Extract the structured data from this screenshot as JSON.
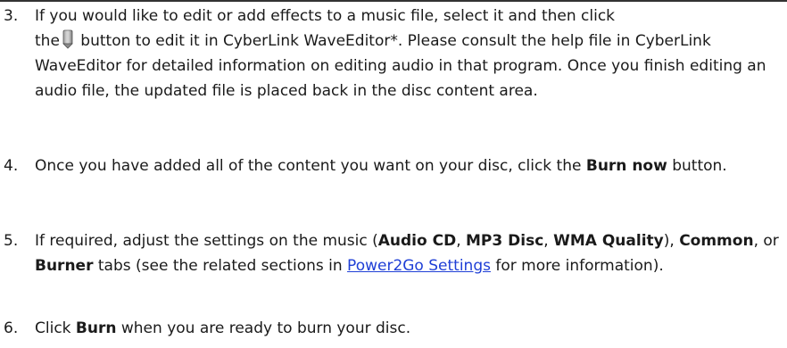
{
  "steps": [
    {
      "number": "3.",
      "line1": "If you would like to edit or add effects to a music file, select it and then click",
      "pre_icon": "the",
      "icon": "edit-pencil-icon",
      "post_icon": " button to edit it in CyberLink WaveEditor*. Please consult the help file in CyberLink WaveEditor for detailed information on editing audio in that program. Once you finish editing an audio file, the updated file is placed back in the disc content area."
    },
    {
      "number": "4.",
      "before": "Once you have added all of the content you want on your disc, click the ",
      "bold": "Burn now",
      "after": " button."
    },
    {
      "number": "5.",
      "t1": "If required, adjust the settings on the music (",
      "b1": "Audio CD",
      "t2": ", ",
      "b2": "MP3 Disc",
      "t3": ", ",
      "b3": "WMA Quality",
      "t4": "), ",
      "b4": "Common",
      "t5": ", or ",
      "b5": "Burner",
      "t6": " tabs (see the related sections in ",
      "link": "Power2Go Settings",
      "t7": " for more information)."
    },
    {
      "number": "6.",
      "before": "Click ",
      "bold": "Burn",
      "after": " when you are ready to burn your disc."
    }
  ]
}
